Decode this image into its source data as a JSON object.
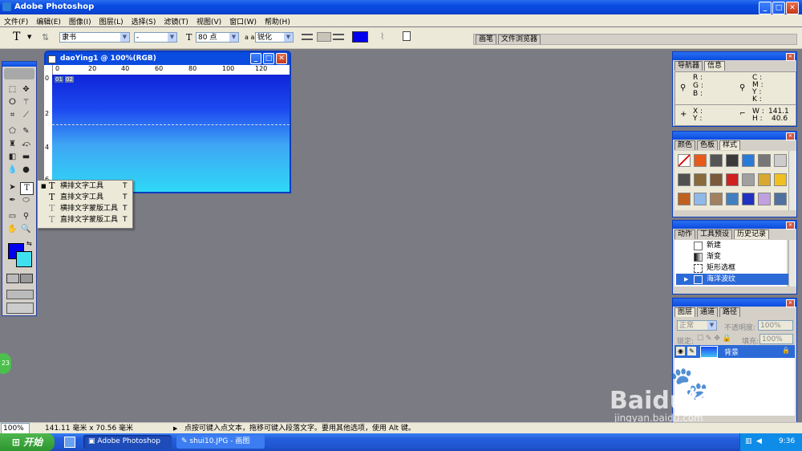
{
  "window": {
    "title": "Adobe Photoshop"
  },
  "menu": [
    "文件(F)",
    "编辑(E)",
    "图像(I)",
    "图层(L)",
    "选择(S)",
    "滤镜(T)",
    "视图(V)",
    "窗口(W)",
    "帮助(H)"
  ],
  "options": {
    "tool_glyph": "T",
    "font_family": "隶书",
    "font_style": "-",
    "font_size": "80 点",
    "aa_label": "a a",
    "aa_mode": "锐化",
    "text_color": "#0000ee",
    "well_tabs": [
      "画笔",
      "文件浏览器"
    ]
  },
  "document": {
    "title": "daoYing1 @ 100%(RGB)",
    "ruler_ticks": [
      "0",
      "20",
      "40",
      "60",
      "80",
      "100",
      "120"
    ],
    "ruler_v_ticks": [
      "0",
      "2",
      "4",
      "6"
    ],
    "slice_labels": [
      "01",
      "02"
    ]
  },
  "flyout": {
    "items": [
      {
        "label": "横排文字工具",
        "key": "T",
        "selected": true
      },
      {
        "label": "直排文字工具",
        "key": "T",
        "selected": false
      },
      {
        "label": "横排文字蒙版工具",
        "key": "T",
        "selected": false
      },
      {
        "label": "直排文字蒙版工具",
        "key": "T",
        "selected": false
      }
    ]
  },
  "colors": {
    "foreground": "#0000ee",
    "background": "#40e0f0"
  },
  "navigator": {
    "tabs": [
      "导航器",
      "信息"
    ],
    "rgb_labels": [
      "R :",
      "G :",
      "B :"
    ],
    "cmyk_labels": [
      "C :",
      "M :",
      "Y :",
      "K :"
    ],
    "xy_labels": [
      "X :",
      "Y :"
    ],
    "w_label": "W :",
    "h_label": "H :",
    "w_value": "141.1",
    "h_value": "40.6"
  },
  "swatches": {
    "tabs": [
      "颜色",
      "色板",
      "样式"
    ],
    "colors": [
      "#ffffff",
      "#e85a1a",
      "#555555",
      "#3a3a3a",
      "#2a7ad8",
      "#777777",
      "#cccccc",
      "#505050",
      "#8a6a3a",
      "#7a5a3a",
      "#d02020",
      "#a0a0a0",
      "#d8a830",
      "#f0c020",
      "#c06020",
      "#90b8e8",
      "#a08060",
      "#4080c0",
      "#2030c0",
      "#c0a0e0",
      "#5070a0"
    ]
  },
  "history": {
    "tabs": [
      "动作",
      "工具预设",
      "历史记录"
    ],
    "items": [
      "新建",
      "渐变",
      "矩形选框",
      "海洋波纹"
    ]
  },
  "layers": {
    "tabs": [
      "图层",
      "通道",
      "路径"
    ],
    "blend_mode": "正常",
    "opacity_label": "不透明度:",
    "opacity_value": "100%",
    "lock_label": "锁定:",
    "fill_label": "填充:",
    "fill_value": "100%",
    "layer_name": "背景"
  },
  "status": {
    "zoom": "100%",
    "dims": "141.11 毫米 x 70.56 毫米",
    "hint": "点按可键入点文本，拖移可键入段落文字。要用其他选项，使用 Alt 键。"
  },
  "taskbar": {
    "start": "开始",
    "tasks": [
      "Adobe Photoshop",
      "shui10.JPG - 画图"
    ],
    "time": "9:36"
  },
  "watermark": {
    "brand": "Baidu经验",
    "url": "jingyan.baidu.com",
    "badge": "23"
  }
}
